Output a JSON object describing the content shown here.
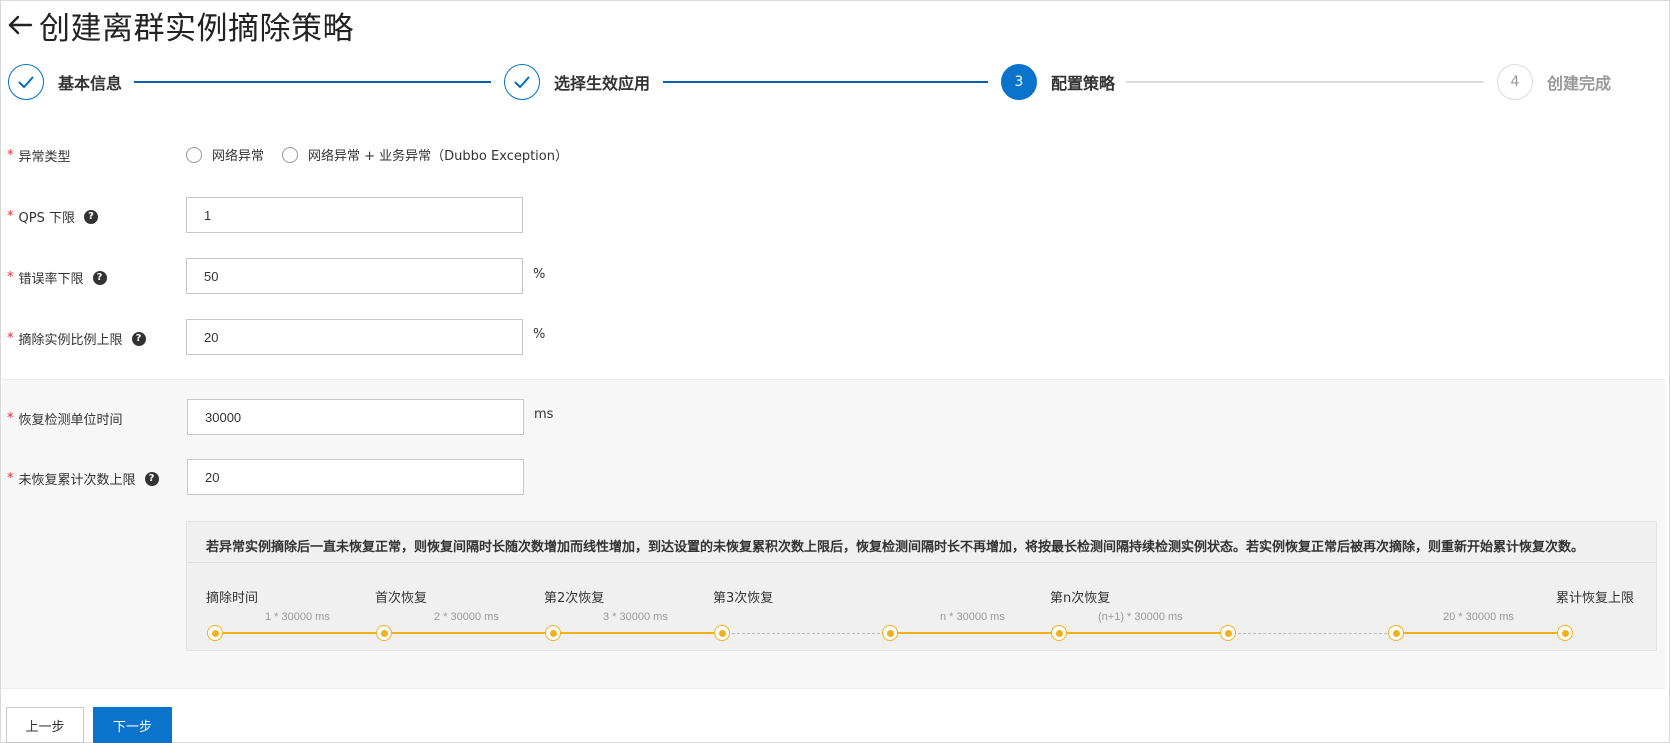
{
  "header": {
    "title": "创建离群实例摘除策略"
  },
  "steps": [
    {
      "index": "1",
      "label": "基本信息",
      "state": "done"
    },
    {
      "index": "2",
      "label": "选择生效应用",
      "state": "done"
    },
    {
      "index": "3",
      "label": "配置策略",
      "state": "active"
    },
    {
      "index": "4",
      "label": "创建完成",
      "state": "todo"
    }
  ],
  "form": {
    "exception_type": {
      "label": "异常类型",
      "options": [
        "网络异常",
        "网络异常 + 业务异常（Dubbo Exception）"
      ]
    },
    "qps": {
      "label": "QPS 下限",
      "value": "1"
    },
    "error_rate": {
      "label": "错误率下限",
      "value": "50",
      "unit": "%"
    },
    "eject_ratio": {
      "label": "摘除实例比例上限",
      "value": "20",
      "unit": "%"
    },
    "recovery_unit": {
      "label": "恢复检测单位时间",
      "value": "30000",
      "unit": "ms"
    },
    "max_recovery": {
      "label": "未恢复累计次数上限",
      "value": "20"
    }
  },
  "info": {
    "text": "若异常实例摘除后一直未恢复正常，则恢复间隔时长随次数增加而线性增加，到达设置的未恢复累积次数上限后，恢复检测间隔时长不再增加，将按最长检测间隔持续检测实例状态。若实例恢复正常后被再次摘除，则重新开始累计恢复次数。",
    "timeline_labels": [
      "摘除时间",
      "首次恢复",
      "第2次恢复",
      "第3次恢复",
      "第n次恢复",
      "累计恢复上限"
    ],
    "timeline_intervals": [
      "1 * 30000 ms",
      "2 * 30000 ms",
      "3 * 30000 ms",
      "n * 30000 ms",
      "(n+1) * 30000 ms",
      "20 * 30000 ms"
    ]
  },
  "buttons": {
    "prev": "上一步",
    "next": "下一步"
  },
  "colors": {
    "primary": "#0a73cc",
    "timeline": "#f2b01e",
    "required": "#e62e2e"
  }
}
